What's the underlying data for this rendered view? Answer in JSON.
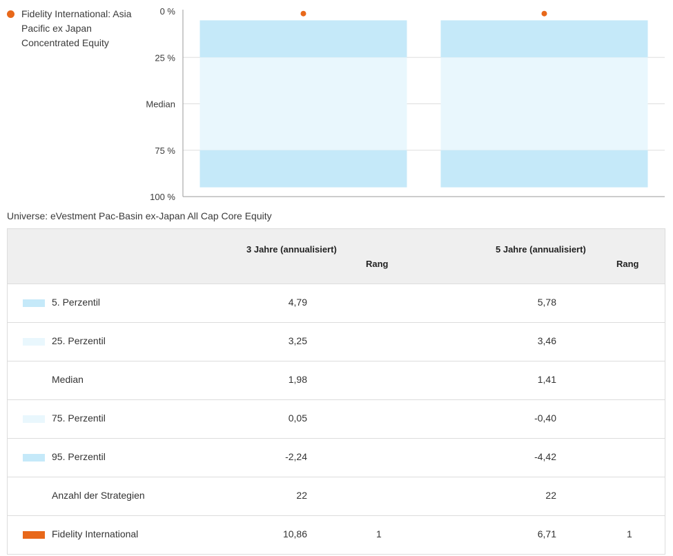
{
  "legend": {
    "label": "Fidelity International: Asia Pacific ex Japan Concentrated Equity",
    "color": "#e8681a"
  },
  "chart_data": {
    "type": "bar",
    "chart_kind": "percentile-range",
    "y_axis_ticks": [
      "0 %",
      "25 %",
      "Median",
      "75 %",
      "100 %"
    ],
    "y_axis_reversed": true,
    "ylim": [
      0,
      100
    ],
    "grid": true,
    "categories": [
      "3 Jahre (annualisiert)",
      "5 Jahre (annualisiert)"
    ],
    "bands": [
      {
        "from_percentile": 5,
        "to_percentile": 25,
        "color": "#c5e9f9"
      },
      {
        "from_percentile": 25,
        "to_percentile": 75,
        "color": "#e9f7fd"
      },
      {
        "from_percentile": 75,
        "to_percentile": 95,
        "color": "#c5e9f9"
      }
    ],
    "marker": {
      "series": "Fidelity International",
      "rank_percentile": [
        1,
        1
      ],
      "color": "#e8681a"
    }
  },
  "universe": "Universe: eVestment Pac-Basin ex-Japan All Cap Core Equity",
  "table": {
    "header": {
      "col1": "3 Jahre (annualisiert)",
      "rank1": "Rang",
      "col2": "5 Jahre (annualisiert)",
      "rank2": "Rang"
    },
    "rows": [
      {
        "label": "5. Perzentil",
        "swatch": "#c5e9f9",
        "v3": "4,79",
        "r3": "",
        "v5": "5,78",
        "r5": ""
      },
      {
        "label": "25. Perzentil",
        "swatch": "#e9f7fd",
        "v3": "3,25",
        "r3": "",
        "v5": "3,46",
        "r5": ""
      },
      {
        "label": "Median",
        "swatch": "",
        "v3": "1,98",
        "r3": "",
        "v5": "1,41",
        "r5": ""
      },
      {
        "label": "75. Perzentil",
        "swatch": "#e9f7fd",
        "v3": "0,05",
        "r3": "",
        "v5": "-0,40",
        "r5": ""
      },
      {
        "label": "95. Perzentil",
        "swatch": "#c5e9f9",
        "v3": "-2,24",
        "r3": "",
        "v5": "-4,42",
        "r5": ""
      },
      {
        "label": "Anzahl der Strategien",
        "swatch": "",
        "v3": "22",
        "r3": "",
        "v5": "22",
        "r5": ""
      },
      {
        "label": "Fidelity International",
        "swatch": "#e8681a",
        "v3": "10,86",
        "r3": "1",
        "v5": "6,71",
        "r5": "1"
      }
    ]
  }
}
